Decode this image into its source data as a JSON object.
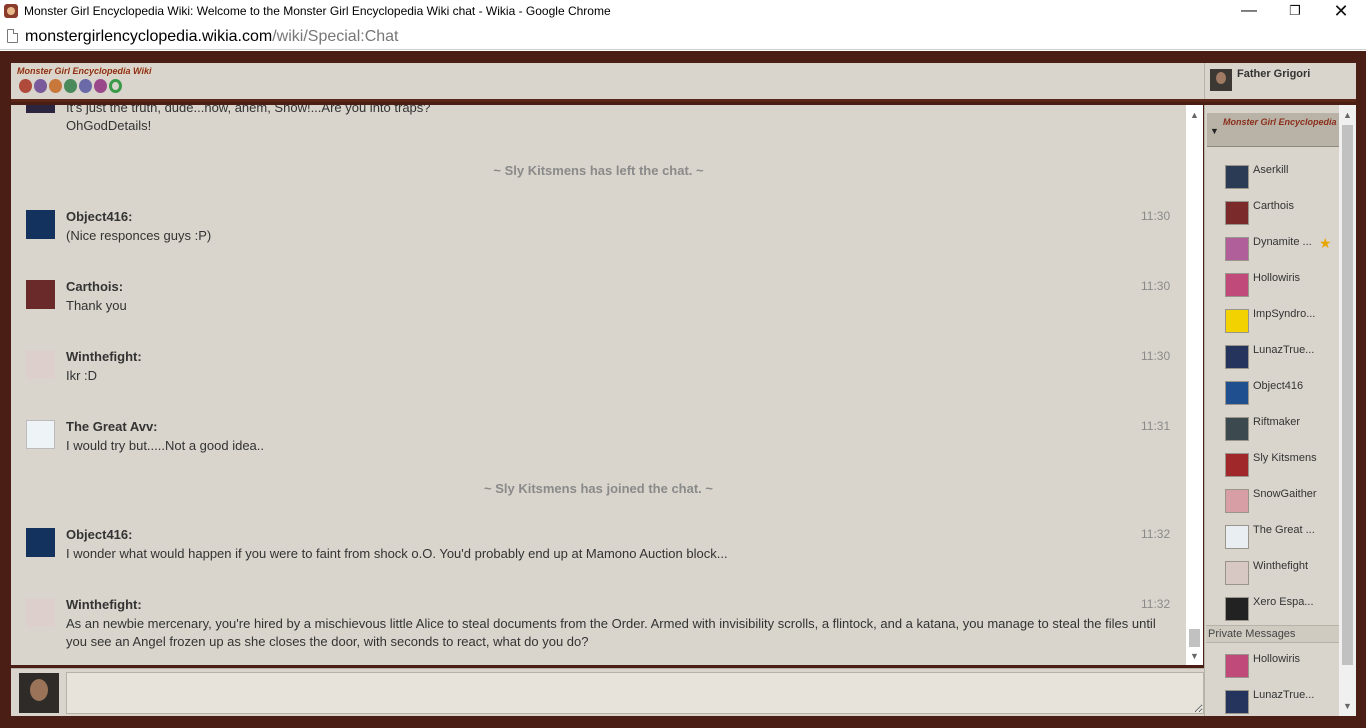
{
  "window": {
    "title": "Monster Girl Encyclopedia Wiki: Welcome to the Monster Girl Encyclopedia Wiki chat - Wikia - Google Chrome",
    "minimize": "—",
    "maximize": "❐",
    "close": "✕"
  },
  "address": {
    "domain": "monstergirlencyclopedia.wikia.com",
    "path": "/wiki/Special:Chat"
  },
  "header": {
    "logo_text": "Monster Girl Encyclopedia Wiki",
    "self_name": "Father Grigori"
  },
  "chat": {
    "top_partial_line": "It's just the truth, dude...now, ahem, Snow!...Are you into traps?",
    "top_partial_line2": "OhGodDetails!",
    "alert_left": "~ Sly Kitsmens has left the chat. ~",
    "alert_joined": "~ Sly Kitsmens has joined the chat. ~",
    "messages": [
      {
        "name": "Object416:",
        "text": "(Nice responces guys :P)",
        "time": "11:30"
      },
      {
        "name": "Carthois:",
        "text": "Thank you",
        "time": "11:30"
      },
      {
        "name": "Winthefight:",
        "text": "Ikr :D",
        "time": "11:30"
      },
      {
        "name": "The Great Avv:",
        "text": "I would try but.....Not a good idea..",
        "time": "11:31"
      },
      {
        "name": "Object416:",
        "text": "I wonder what would happen if you were to faint from shock o.O. You'd probably end up at Mamono Auction block...",
        "time": "11:32"
      },
      {
        "name": "Winthefight:",
        "text": "As an newbie mercenary, you're hired by a mischievous little Alice to steal documents from the Order. Armed with invisibility scrolls, a flintock, and a katana, you manage to steal the files until you see an Angel frozen up as she closes the door, with seconds to react, what do you do?",
        "time": "11:32"
      }
    ]
  },
  "input": {
    "value": ""
  },
  "userlist": {
    "banner_text": "Monster Girl Encyclopedia Wiki",
    "users": [
      {
        "name": "Aserkill",
        "color": "#2b3a55"
      },
      {
        "name": "Carthois",
        "color": "#7a2a2a"
      },
      {
        "name": "Dynamite ...",
        "color": "#b05f9a"
      },
      {
        "name": "Hollowiris",
        "color": "#c04a7a"
      },
      {
        "name": "ImpSyndro...",
        "color": "#f2d200"
      },
      {
        "name": "LunazTrue...",
        "color": "#25345c"
      },
      {
        "name": "Object416",
        "color": "#1f4f8f"
      },
      {
        "name": "Riftmaker",
        "color": "#3c4a4f"
      },
      {
        "name": "Sly Kitsmens",
        "color": "#a0282a"
      },
      {
        "name": "SnowGaither",
        "color": "#d79fa5"
      },
      {
        "name": "The Great ...",
        "color": "#e9eef3"
      },
      {
        "name": "Winthefight",
        "color": "#d8c8c4"
      },
      {
        "name": "Xero Espa...",
        "color": "#222222"
      }
    ],
    "star_icon": "★",
    "private_messages_label": "Private Messages",
    "private": [
      {
        "name": "Hollowiris",
        "color": "#c04a7a"
      },
      {
        "name": "LunazTrue...",
        "color": "#25345c"
      }
    ]
  }
}
